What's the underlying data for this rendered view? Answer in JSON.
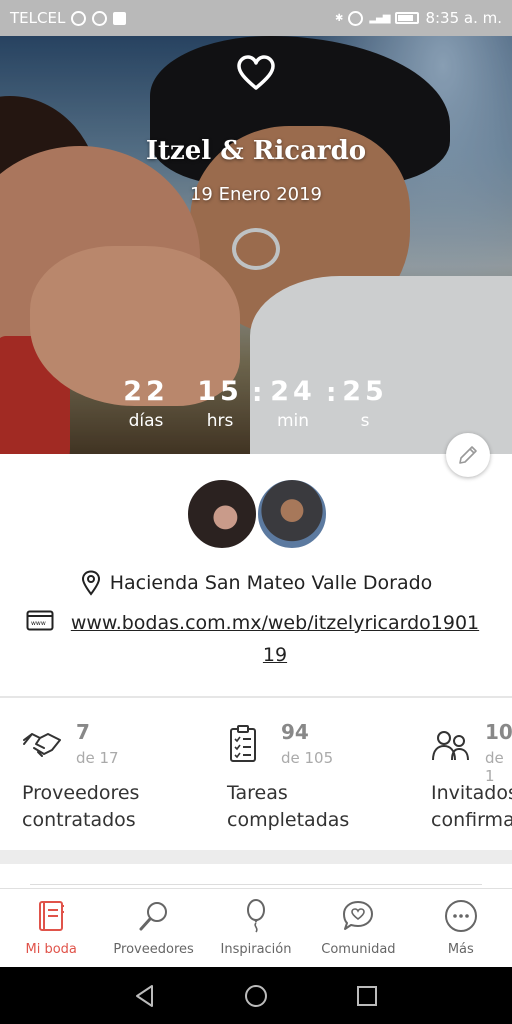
{
  "status_bar": {
    "carrier": "TELCEL",
    "time": "8:35 a. m."
  },
  "hero": {
    "couple_name": "Itzel & Ricardo",
    "date": "19 Enero 2019",
    "countdown": {
      "days": "22",
      "days_label": "días",
      "hours": "15",
      "hours_label": "hrs",
      "minutes": "24",
      "minutes_label": "min",
      "seconds": "25",
      "seconds_label": "s"
    }
  },
  "details": {
    "venue": "Hacienda San Mateo Valle Dorado",
    "website": "www.bodas.com.mx/web/itzelyricardo190119"
  },
  "stats": [
    {
      "value": "7",
      "total": "de 17",
      "label_line1": "Proveedores",
      "label_line2": "contratados",
      "icon": "handshake-icon"
    },
    {
      "value": "94",
      "total": "de 105",
      "label_line1": "Tareas",
      "label_line2": "completadas",
      "icon": "checklist-icon"
    },
    {
      "value": "10",
      "total": "de 1",
      "label_line1": "Invitados",
      "label_line2": "confirma",
      "icon": "guests-icon"
    }
  ],
  "bottom_nav": [
    {
      "label": "Mi boda",
      "icon": "notebook-icon",
      "active": true
    },
    {
      "label": "Proveedores",
      "icon": "search-icon",
      "active": false
    },
    {
      "label": "Inspiración",
      "icon": "balloon-icon",
      "active": false
    },
    {
      "label": "Comunidad",
      "icon": "chat-heart-icon",
      "active": false
    },
    {
      "label": "Más",
      "icon": "more-icon",
      "active": false
    }
  ],
  "colors": {
    "accent": "#e0534a",
    "status_bar": "#b9b9b9",
    "system_nav": "#000000"
  }
}
